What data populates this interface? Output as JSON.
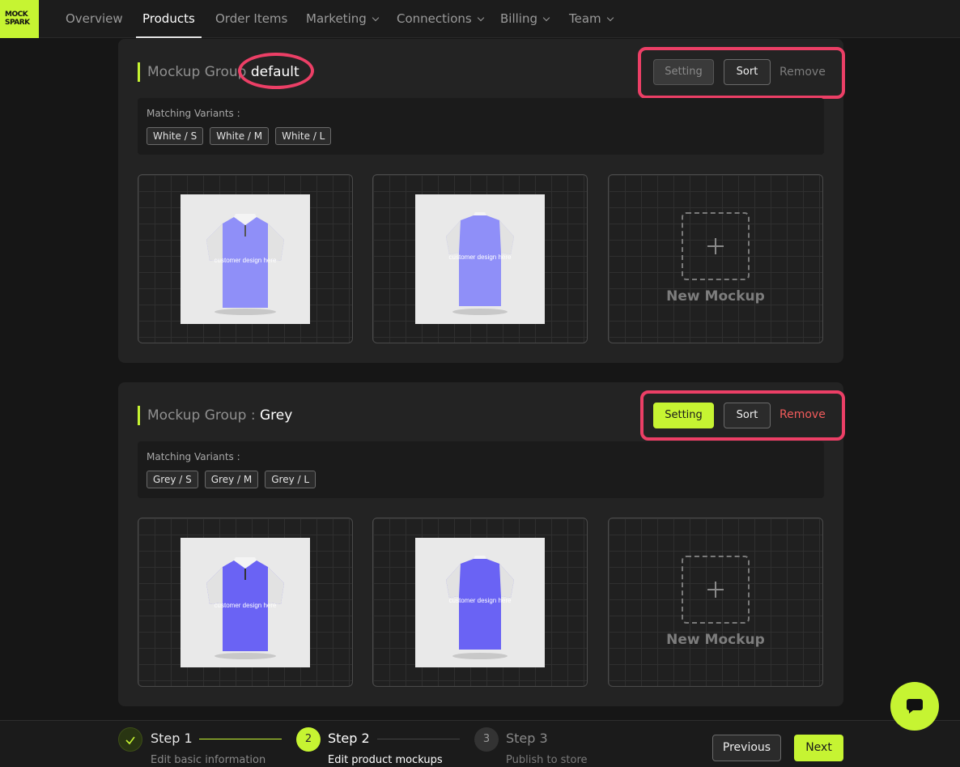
{
  "logo": {
    "line1": "MOCK",
    "line2": "SPARK"
  },
  "nav": {
    "items": [
      {
        "label": "Overview",
        "active": false,
        "dropdown": false
      },
      {
        "label": "Products",
        "active": true,
        "dropdown": false
      },
      {
        "label": "Order Items",
        "active": false,
        "dropdown": false
      },
      {
        "label": "Marketing",
        "active": false,
        "dropdown": true
      },
      {
        "label": "Connections",
        "active": false,
        "dropdown": true
      },
      {
        "label": "Billing",
        "active": false,
        "dropdown": true
      },
      {
        "label": "Team",
        "active": false,
        "dropdown": true
      }
    ]
  },
  "groups": [
    {
      "title_prefix": "Mockup Group",
      "name": "default",
      "setting_label": "Setting",
      "setting_enabled": false,
      "sort_label": "Sort",
      "remove_label": "Remove",
      "remove_enabled": false,
      "variants_label": "Matching Variants :",
      "variants": [
        "White / S",
        "White / M",
        "White / L"
      ],
      "mockup_text": "customer design here",
      "new_mockup_label": "New Mockup"
    },
    {
      "title_prefix": "Mockup Group :",
      "name": "Grey",
      "setting_label": "Setting",
      "setting_enabled": true,
      "sort_label": "Sort",
      "remove_label": "Remove",
      "remove_enabled": true,
      "variants_label": "Matching Variants :",
      "variants": [
        "Grey / S",
        "Grey / M",
        "Grey / L"
      ],
      "mockup_text": "customer design here",
      "new_mockup_label": "New Mockup"
    }
  ],
  "steps": [
    {
      "number": "1",
      "title": "Step 1",
      "desc": "Edit basic information",
      "state": "done"
    },
    {
      "number": "2",
      "title": "Step 2",
      "desc": "Edit product mockups",
      "state": "current"
    },
    {
      "number": "3",
      "title": "Step 3",
      "desc": "Publish to store",
      "state": "todo"
    }
  ],
  "footer": {
    "previous_label": "Previous",
    "next_label": "Next"
  },
  "colors": {
    "accent": "#c6f432",
    "highlight": "#ec3f66",
    "danger": "#f15b5b",
    "shirt_light": "#8f8ff8",
    "shirt_dark": "#6a63f4"
  },
  "icons": {
    "check": "check-icon",
    "chat": "chat-bubble-icon",
    "plus": "plus-icon",
    "chevron": "chevron-down-icon"
  }
}
